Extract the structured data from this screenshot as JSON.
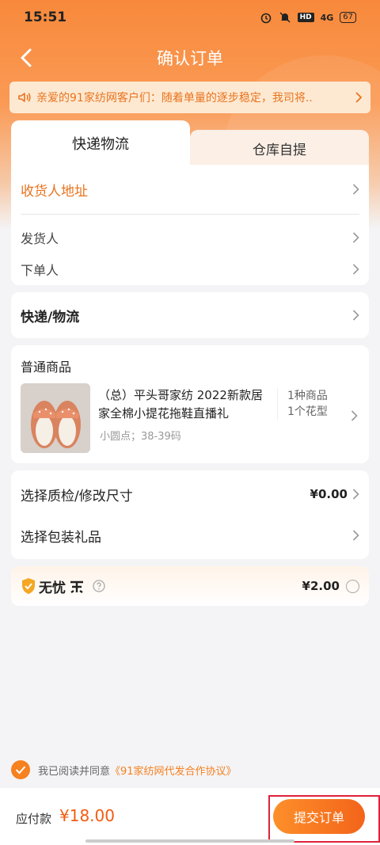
{
  "status_bar": {
    "time": "15:51",
    "signal": "4G",
    "battery": "67"
  },
  "nav": {
    "title": "确认订单"
  },
  "notice": {
    "text": "亲爱的91家纺网客户们：随着单量的逐步稳定，我司将.."
  },
  "tabs": [
    {
      "label": "快递物流"
    },
    {
      "label": "仓库自提"
    }
  ],
  "address": {
    "consignee_label": "收货人地址",
    "sender_label": "发货人",
    "orderer_label": "下单人"
  },
  "shipping": {
    "label": "快递/物流"
  },
  "goods": {
    "section_label": "普通商品",
    "product_title": "（总）平头哥家纺 2022新款居家全棉小提花拖鞋直播礼",
    "spec": "小圆点；38-39码",
    "count": "1种商品",
    "patterns": "1个花型"
  },
  "services": {
    "qc_label": "选择质检/修改尺寸",
    "qc_price": "¥0.00",
    "gift_label": "选择包装礼品"
  },
  "worry_free": {
    "label": "无忧",
    "price": "¥2.00"
  },
  "agreement": {
    "prefix": "我已阅读并同意",
    "link": "《91家纺网代发合作协议》"
  },
  "footer": {
    "pay_label": "应付款",
    "pay_amount": "¥18.00",
    "submit_label": "提交订单"
  },
  "colors": {
    "accent": "#f7801f",
    "price_red": "#f35b10",
    "highlight": "#e0213b"
  }
}
